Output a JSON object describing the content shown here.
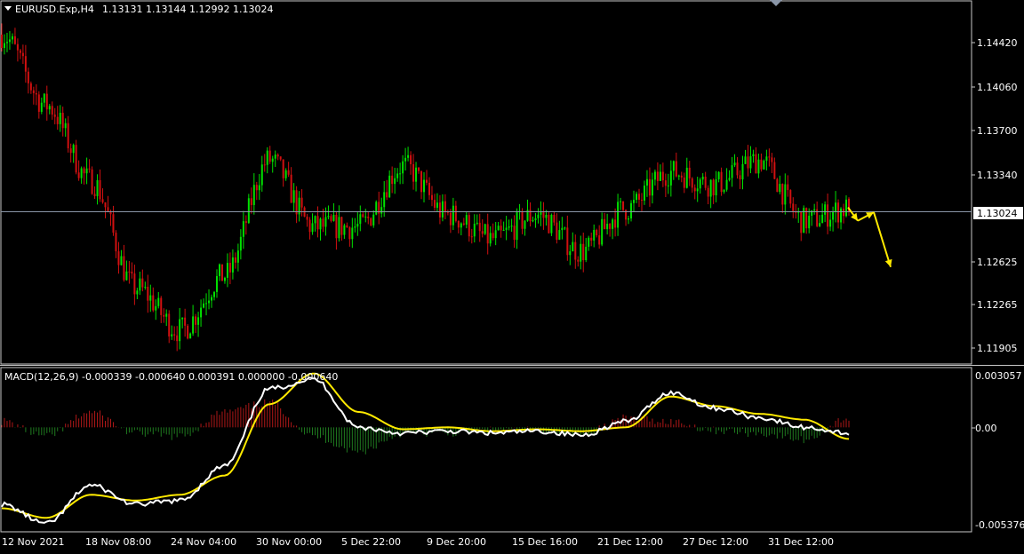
{
  "window": {
    "title": "EURUSD.Exp,H4",
    "ohlc": "1.13131 1.13144 1.12992 1.13024"
  },
  "colors": {
    "background": "#000000",
    "frame": "#c8c8c8",
    "bull_candle": "#00e000",
    "bear_candle": "#d01010",
    "bid_line": "#8a96a8",
    "hist_pos": "#b01818",
    "hist_neg": "#1f7a1f",
    "macd_line": "#ffffff",
    "signal_line": "#ffea00",
    "arrow": "#ffea00",
    "text": "#ffffff"
  },
  "price_axis": {
    "labels": [
      "1.14420",
      "1.14060",
      "1.13700",
      "1.13340",
      "1.12625",
      "1.12265",
      "1.11905"
    ],
    "current_price": "1.13024"
  },
  "macd": {
    "header": "MACD(12,26,9) -0.000339 -0.000640 0.000391 0.000000 -0.000640",
    "axis_labels": [
      "0.003057",
      "0.00",
      "-0.005376"
    ]
  },
  "time_axis": {
    "labels": [
      "12 Nov 2021",
      "18 Nov 08:00",
      "24 Nov 04:00",
      "30 Nov 00:00",
      "5 Dec 22:00",
      "9 Dec 20:00",
      "15 Dec 16:00",
      "21 Dec 12:00",
      "27 Dec 12:00",
      "31 Dec 12:00"
    ]
  },
  "chart_data": [
    {
      "type": "candlestick",
      "title": "EURUSD.Exp,H4",
      "timeframe": "H4",
      "last_bar": {
        "open": 1.13131,
        "high": 1.13144,
        "low": 1.12992,
        "close": 1.13024
      },
      "ylim": [
        1.1178,
        1.1475
      ],
      "x_labels": [
        "12 Nov 2021",
        "18 Nov 08:00",
        "24 Nov 04:00",
        "30 Nov 00:00",
        "5 Dec 22:00",
        "9 Dec 20:00",
        "15 Dec 16:00",
        "21 Dec 12:00",
        "27 Dec 12:00",
        "31 Dec 12:00"
      ],
      "y_labels": [
        "1.14420",
        "1.14060",
        "1.13700",
        "1.13340",
        "1.12625",
        "1.12265",
        "1.11905"
      ],
      "current_price": 1.13024,
      "close_path": {
        "x": [
          "12 Nov 2021",
          "16 Nov",
          "18 Nov 08:00",
          "22 Nov",
          "24 Nov 04:00",
          "25 Nov",
          "30 Nov 00:00",
          "2 Dec",
          "5 Dec 22:00",
          "7 Dec",
          "9 Dec 20:00",
          "13 Dec",
          "15 Dec 16:00",
          "17 Dec",
          "21 Dec 12:00",
          "23 Dec",
          "27 Dec 12:00",
          "29 Dec",
          "31 Dec 12:00",
          "3 Jan"
        ],
        "y": [
          1.1448,
          1.139,
          1.1328,
          1.124,
          1.1205,
          1.125,
          1.1345,
          1.129,
          1.129,
          1.134,
          1.13,
          1.128,
          1.13,
          1.127,
          1.1305,
          1.1335,
          1.1325,
          1.1345,
          1.1295,
          1.1305
        ]
      },
      "forecast_arrows": [
        {
          "from_price": 1.1306,
          "to_price": 1.1295
        },
        {
          "from_price": 1.1295,
          "to_price": 1.1302
        },
        {
          "from_price": 1.1302,
          "to_price": 1.1257
        }
      ]
    },
    {
      "type": "line",
      "title": "MACD(12,26,9) -0.000339 -0.000640 0.000391 0.000000 -0.000640",
      "ylim": [
        -0.005376,
        0.003057
      ],
      "y_labels": [
        "0.003057",
        "0.00",
        "-0.005376"
      ],
      "x": [
        "12 Nov 2021",
        "16 Nov",
        "18 Nov 08:00",
        "22 Nov",
        "24 Nov 04:00",
        "25 Nov",
        "30 Nov 00:00",
        "2 Dec",
        "5 Dec 22:00",
        "7 Dec",
        "9 Dec 20:00",
        "13 Dec",
        "15 Dec 16:00",
        "17 Dec",
        "21 Dec 12:00",
        "23 Dec",
        "27 Dec 12:00",
        "29 Dec",
        "31 Dec 12:00",
        "3 Jan"
      ],
      "series": [
        {
          "values": [
            -0.004,
            -0.005,
            -0.003,
            -0.004,
            -0.0038,
            -0.002,
            0.002,
            0.0025,
            0.0,
            -0.0003,
            -0.0002,
            -0.0003,
            -0.0002,
            -0.0004,
            0.0003,
            0.0018,
            0.001,
            0.0005,
            0.0,
            -0.0003
          ]
        },
        {
          "values": [
            -0.0042,
            -0.0047,
            -0.0035,
            -0.0038,
            -0.0035,
            -0.0025,
            0.0012,
            0.0028,
            0.0008,
            -0.0001,
            0.0,
            -0.0002,
            -0.0001,
            -0.0002,
            0.0,
            0.0016,
            0.0011,
            0.0007,
            0.0004,
            -0.0006
          ]
        }
      ]
    }
  ]
}
